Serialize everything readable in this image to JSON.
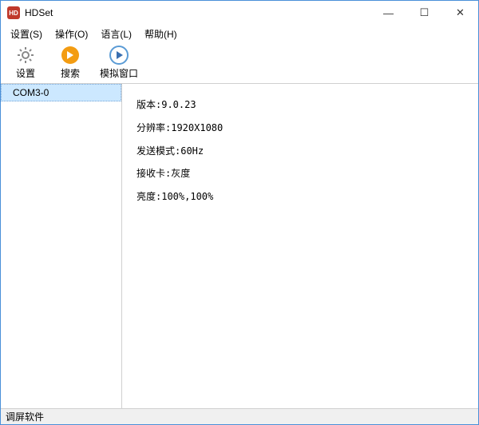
{
  "window": {
    "title": "HDSet",
    "icon_text": "HD"
  },
  "titlebar_buttons": {
    "minimize": "—",
    "maximize": "☐",
    "close": "✕"
  },
  "menubar": {
    "settings": "设置(S)",
    "operation": "操作(O)",
    "language": "语言(L)",
    "help": "帮助(H)"
  },
  "toolbar": {
    "settings_label": "设置",
    "search_label": "搜索",
    "simwin_label": "模拟窗口"
  },
  "sidebar": {
    "items": [
      {
        "label": "COM3-0"
      }
    ]
  },
  "info": {
    "version_label": "版本:",
    "version_value": "9.0.23",
    "resolution_label": "分辨率:",
    "resolution_value": "1920X1080",
    "sendmode_label": "发送模式:",
    "sendmode_value": "60Hz",
    "receiver_label": "接收卡:",
    "receiver_value": "灰度",
    "brightness_label": "亮度:",
    "brightness_value": "100%,100%"
  },
  "statusbar": {
    "text": "调屏软件"
  }
}
